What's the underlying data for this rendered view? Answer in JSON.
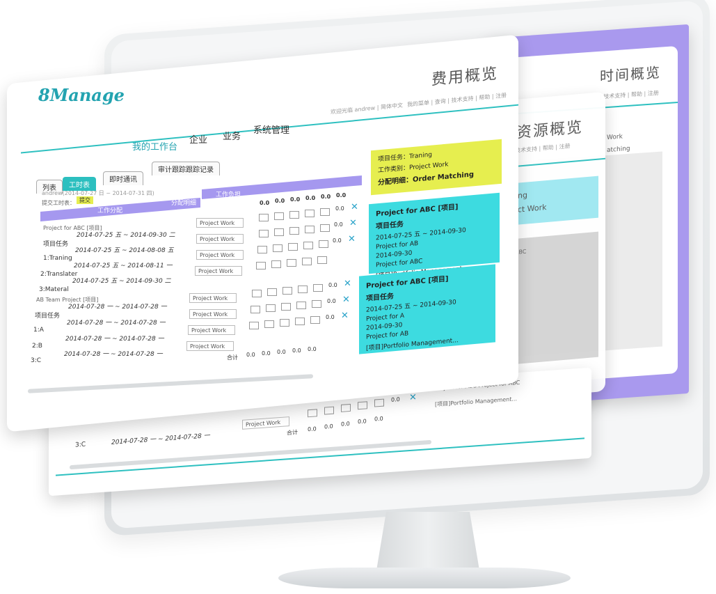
{
  "app": {
    "logo": "8Manage"
  },
  "nav": {
    "items": [
      "我的工作台",
      "企业",
      "业务",
      "系统管理"
    ]
  },
  "header": {
    "welcome": "欢迎光临 andrew | 简体中文",
    "links": "我的菜单 | 查询 | 技术支持 | 帮助 | 注册"
  },
  "panels": {
    "cost_title": "费用概览",
    "resource_title": "资源概览",
    "time_title": "时间概览",
    "time_links": "| 技术支持 | 帮助 | 注册",
    "resource_links": "技术支持 | 帮助 | 注册"
  },
  "tabs": [
    "列表",
    "工时表",
    "即时通讯",
    "审计跟踪跟踪记录"
  ],
  "timesheet": {
    "user_line": "andrew(2014-07-27 日 ~ 2014-07-31 四)",
    "submit_label": "提交工时表：",
    "submit_button": "提交",
    "col_assignment": "工作分配",
    "col_detail": "分配明细",
    "col_workload": "工作负担",
    "col_totals": [
      "0.0",
      "0.0",
      "0.0",
      "0.0",
      "0.0",
      "0.0"
    ],
    "project1": "Project for ABC [项目]",
    "project2": "AB Team Project [项目]",
    "rows": [
      {
        "label": "项目任务",
        "dates": "2014-07-25 五 ~ 2014-09-30 二",
        "select": "Project Work",
        "total": "0.0"
      },
      {
        "label": "1:Traning",
        "dates": "2014-07-25 五 ~ 2014-08-08 五",
        "select": "Project Work",
        "total": "0.0"
      },
      {
        "label": "2:Translater",
        "dates": "2014-07-25 五 ~ 2014-08-11 一",
        "select": "Project Work",
        "total": "0.0"
      },
      {
        "label": "3:Materal",
        "dates": "2014-07-25 五 ~ 2014-09-30 二",
        "select": "Project Work",
        "total": ""
      },
      {
        "label": "项目任务",
        "dates": "2014-07-28 一 ~ 2014-07-28 一",
        "select": "Project Work",
        "total": "0.0"
      },
      {
        "label": "1:A",
        "dates": "2014-07-28 一 ~ 2014-07-28 一",
        "select": "Project Work",
        "total": "0.0"
      },
      {
        "label": "2:B",
        "dates": "2014-07-28 一 ~ 2014-07-28 一",
        "select": "Project Work",
        "total": "0.0"
      },
      {
        "label": "3:C",
        "dates": "2014-07-28 一 ~ 2014-07-28 一",
        "select": "",
        "total": ""
      }
    ],
    "sum_label": "合计",
    "sum_values": [
      "0.0",
      "0.0",
      "0.0",
      "0.0",
      "0.0"
    ]
  },
  "cards": {
    "yellow": {
      "task": "项目任务：Traning",
      "type": "工作类别：Project Work",
      "detail": "分配明细：Order Matching"
    },
    "cyan1": {
      "title": "Project for ABC [项目]",
      "task": "项目任务",
      "dates": "2014-07-25 五 ~ 2014-09-30",
      "proj": "Project for AB",
      "date2": "2014-09-30",
      "proj2": "Project for ABC",
      "link": "[项目]Portfolio Management..."
    },
    "cyan2": {
      "title": "Project for ABC [项目]",
      "task": "项目任务",
      "dates": "2014-07-25 五 ~ 2014-09-30",
      "proj": "Project for A",
      "date2": "2014-09-30",
      "proj2": "Project for AB",
      "link": "[项目]Portfolio Management..."
    }
  },
  "resource": {
    "ghost1": "hing",
    "ghost2": "ject Work",
    "ghost3": "ABC",
    "ghost4": "Work",
    "ghost5": "atching"
  },
  "bottom": {
    "row_label": "3:C",
    "row_dates": "2014-07-28 一 ~ 2014-07-28 一",
    "select": "Project Work",
    "total": "0.0",
    "sum_label": "合计",
    "sum_values": [
      "0.0",
      "0.0",
      "0.0",
      "0.0",
      "0.0"
    ],
    "right_date": "2014-09-30",
    "right_proj": "Project for ABC Project for ABC",
    "right_link": "[项目]Portfolio Management..."
  }
}
